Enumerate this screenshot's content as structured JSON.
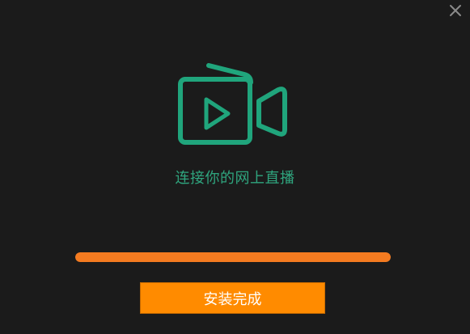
{
  "window": {
    "close_icon": "close-icon"
  },
  "logo": {
    "icon": "video-camera-play-icon",
    "color": "#20a57c"
  },
  "tagline": "连接你的网上直播",
  "progress": {
    "percent": 100,
    "color": "#f47b20"
  },
  "install_button": {
    "label": "安装完成",
    "color": "#ff8b00"
  }
}
